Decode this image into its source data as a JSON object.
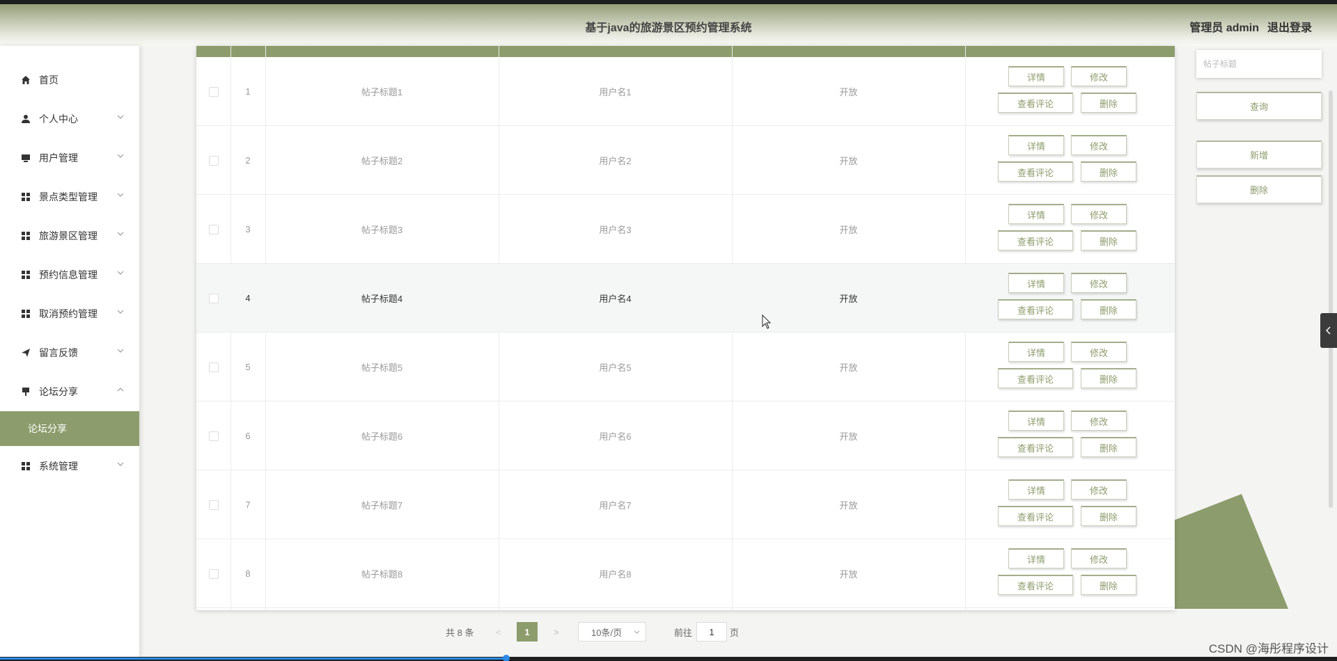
{
  "header": {
    "title": "基于java的旅游景区预约管理系统",
    "user": "管理员 admin",
    "logout": "退出登录"
  },
  "sidebar": {
    "items": [
      {
        "label": "首页",
        "icon": "home-icon"
      },
      {
        "label": "个人中心",
        "icon": "user-icon"
      },
      {
        "label": "用户管理",
        "icon": "monitor-icon"
      },
      {
        "label": "景点类型管理",
        "icon": "grid-icon"
      },
      {
        "label": "旅游景区管理",
        "icon": "grid-icon"
      },
      {
        "label": "预约信息管理",
        "icon": "grid-icon"
      },
      {
        "label": "取消预约管理",
        "icon": "grid-icon"
      },
      {
        "label": "留言反馈",
        "icon": "send-icon"
      },
      {
        "label": "论坛分享",
        "icon": "pin-icon"
      },
      {
        "label": "论坛分享",
        "icon": ""
      },
      {
        "label": "系统管理",
        "icon": "grid-icon"
      }
    ]
  },
  "table": {
    "rows": [
      {
        "index": "1",
        "title": "帖子标题1",
        "user": "用户名1",
        "status": "开放"
      },
      {
        "index": "2",
        "title": "帖子标题2",
        "user": "用户名2",
        "status": "开放"
      },
      {
        "index": "3",
        "title": "帖子标题3",
        "user": "用户名3",
        "status": "开放"
      },
      {
        "index": "4",
        "title": "帖子标题4",
        "user": "用户名4",
        "status": "开放"
      },
      {
        "index": "5",
        "title": "帖子标题5",
        "user": "用户名5",
        "status": "开放"
      },
      {
        "index": "6",
        "title": "帖子标题6",
        "user": "用户名6",
        "status": "开放"
      },
      {
        "index": "7",
        "title": "帖子标题7",
        "user": "用户名7",
        "status": "开放"
      },
      {
        "index": "8",
        "title": "帖子标题8",
        "user": "用户名8",
        "status": "开放"
      }
    ],
    "actions": {
      "detail": "详情",
      "edit": "修改",
      "comments": "查看评论",
      "delete": "删除"
    }
  },
  "search": {
    "placeholder": "帖子标题",
    "query_label": "查询",
    "add_label": "新增",
    "delete_label": "删除"
  },
  "pagination": {
    "total": "共 8 条",
    "prev": "<",
    "current": "1",
    "next": ">",
    "page_size": "10条/页",
    "goto": "前往",
    "goto_value": "1",
    "page_suffix": "页"
  },
  "watermark": "CSDN @海彤程序设计",
  "colors": {
    "accent": "#8d9c6c",
    "header_top": "#949d78",
    "sidebar_active": "#8d9c6c"
  }
}
